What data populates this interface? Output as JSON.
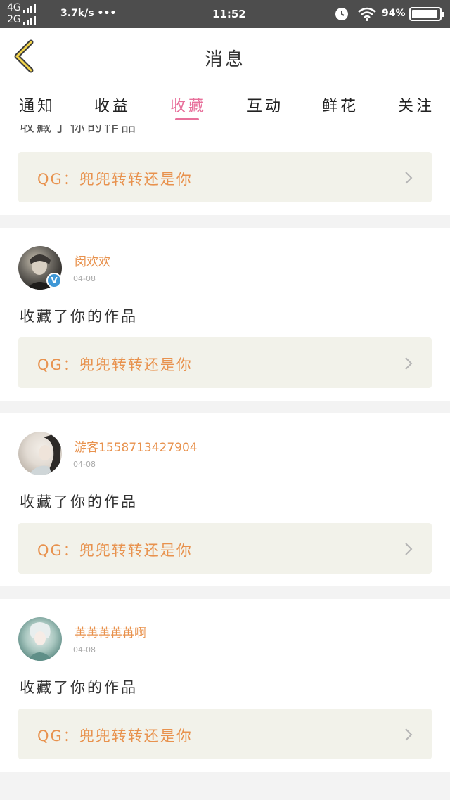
{
  "status": {
    "net_top": "4G",
    "net_bottom": "2G",
    "speed": "3.7k/s •••",
    "time": "11:52",
    "battery": "94%"
  },
  "nav": {
    "title": "消息"
  },
  "tabs": [
    {
      "label": "通知"
    },
    {
      "label": "收益"
    },
    {
      "label": "收藏"
    },
    {
      "label": "互动"
    },
    {
      "label": "鲜花"
    },
    {
      "label": "关注"
    }
  ],
  "active_tab_index": 2,
  "accent_color": "#e8709b",
  "link_color": "#e8924e",
  "first_card": {
    "action": "收藏了你的作品",
    "work": "QG：兜兜转转还是你"
  },
  "items": [
    {
      "user": "闵欢欢",
      "date": "04-08",
      "verified": true,
      "action": "收藏了你的作品",
      "work": "QG：兜兜转转还是你"
    },
    {
      "user": "游客1558713427904",
      "date": "04-08",
      "verified": false,
      "action": "收藏了你的作品",
      "work": "QG：兜兜转转还是你"
    },
    {
      "user": "苒苒苒苒苒啊",
      "date": "04-08",
      "verified": false,
      "action": "收藏了你的作品",
      "work": "QG：兜兜转转还是你"
    }
  ]
}
